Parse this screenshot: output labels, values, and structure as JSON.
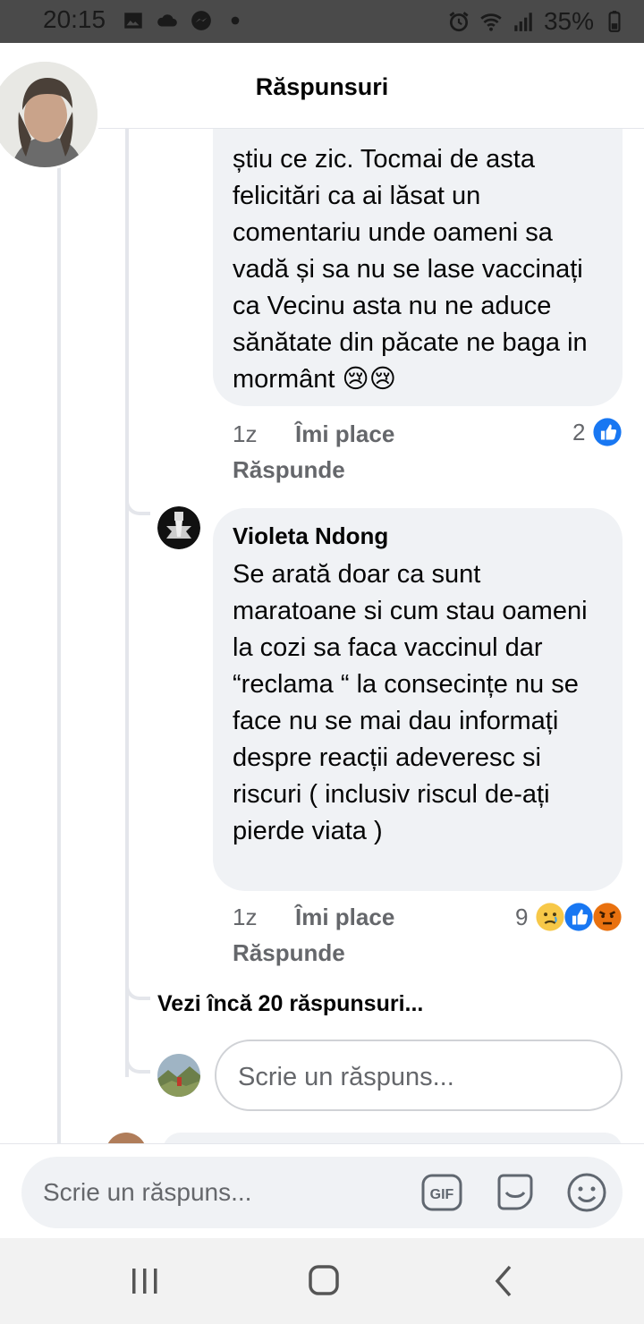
{
  "status_bar": {
    "time": "20:15",
    "battery": "35%"
  },
  "header": {
    "title": "Răspunsuri"
  },
  "comment1": {
    "text": "știu ce zic. Tocmai de asta felicitări ca ai lăsat un comentariu unde oameni sa vadă și sa nu se lase vaccinați ca Vecinu asta nu ne aduce sănătate din păcate ne baga in mormânt 😢😢",
    "time": "1z",
    "like_label": "Îmi place",
    "reply_label": "Răspunde",
    "reaction_count": "2"
  },
  "comment2": {
    "author": "Violeta Ndong",
    "text": "Se arată doar ca sunt maratoane si cum stau oameni la cozi sa faca vaccinul dar “reclama “ la consecințe nu se face nu se mai dau informați despre reacții adeveresc si riscuri ( inclusiv riscul de-ați pierde viata )",
    "time": "1z",
    "like_label": "Îmi place",
    "reply_label": "Răspunde",
    "reaction_count": "9"
  },
  "more_replies": "Vezi încă 20 răspunsuri...",
  "reply_input": {
    "placeholder": "Scrie un răspuns..."
  },
  "compose": {
    "placeholder": "Scrie un răspuns...",
    "gif_label": "GIF"
  },
  "colors": {
    "bubble": "#f0f2f5",
    "like_blue": "#1877f2",
    "meta_gray": "#65676b"
  }
}
